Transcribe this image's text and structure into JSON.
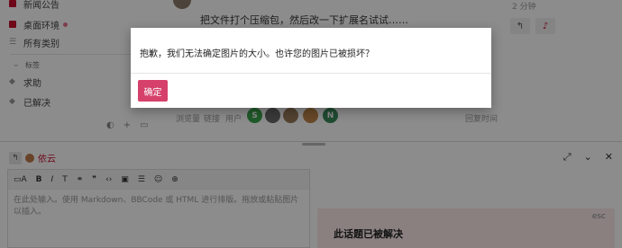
{
  "sidebar": {
    "items": [
      {
        "label": "新闻公告"
      },
      {
        "label": "桌面环境"
      },
      {
        "label": "所有类别"
      }
    ],
    "tags_header": "标签",
    "tags": [
      {
        "label": "求助"
      },
      {
        "label": "已解决"
      }
    ]
  },
  "post": {
    "text": "把文件打个压缩包，然后改一下扩展名试试……",
    "time": "2 分钟",
    "stats": {
      "views_label": "浏览量",
      "links_label": "链接",
      "users_label": "用户",
      "activity_label": "回复时间"
    },
    "participant_letters": [
      "S",
      "N"
    ]
  },
  "composer": {
    "reply_to": "依云",
    "placeholder": "在此处输入。使用 Markdown、BBCode 或 HTML 进行排版。拖放或粘贴图片以插入。"
  },
  "hint": {
    "esc": "esc",
    "title": "此话题已被解决"
  },
  "modal": {
    "message": "抱歉，我们无法确定图片的大小。也许您的图片已被损坏？",
    "ok_label": "确定"
  },
  "colors": {
    "accent": "#d6416b",
    "brand_red": "#c8102e"
  }
}
